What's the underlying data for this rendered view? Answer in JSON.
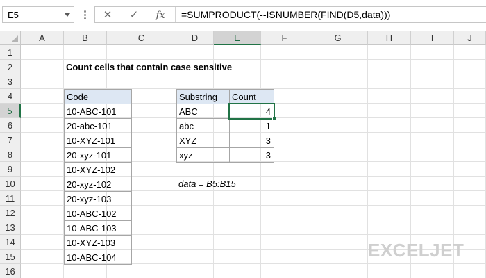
{
  "formula_bar": {
    "name_box": "E5",
    "formula": "=SUMPRODUCT(--ISNUMBER(FIND(D5,data)))",
    "cancel_icon": "x-icon",
    "enter_icon": "check-icon",
    "function_icon": "fx-icon"
  },
  "columns": [
    "A",
    "B",
    "C",
    "D",
    "E",
    "F",
    "G",
    "H",
    "I",
    "J"
  ],
  "rows": [
    "1",
    "2",
    "3",
    "4",
    "5",
    "6",
    "7",
    "8",
    "9",
    "10",
    "11",
    "12",
    "13",
    "14",
    "15",
    "16"
  ],
  "selected_cell": "E5",
  "sheet": {
    "title": "Count cells that contain case sensitive",
    "code_header": "Code",
    "codes": [
      "10-ABC-101",
      "20-abc-101",
      "10-XYZ-101",
      "20-xyz-101",
      "10-XYZ-102",
      "20-xyz-102",
      "20-xyz-103",
      "10-ABC-102",
      "10-ABC-103",
      "10-XYZ-103",
      "10-ABC-104"
    ],
    "summary_headers": [
      "Substring",
      "Count"
    ],
    "summary": [
      {
        "substring": "ABC",
        "count": "4"
      },
      {
        "substring": "abc",
        "count": "1"
      },
      {
        "substring": "XYZ",
        "count": "3"
      },
      {
        "substring": "xyz",
        "count": "3"
      }
    ],
    "note": "data = B5:B15"
  },
  "branding": {
    "logo_text": "EXCELJET",
    "logo_color": "#cfcfcf"
  },
  "colors": {
    "accent": "#217346",
    "header_fill": "#dde7f3"
  }
}
